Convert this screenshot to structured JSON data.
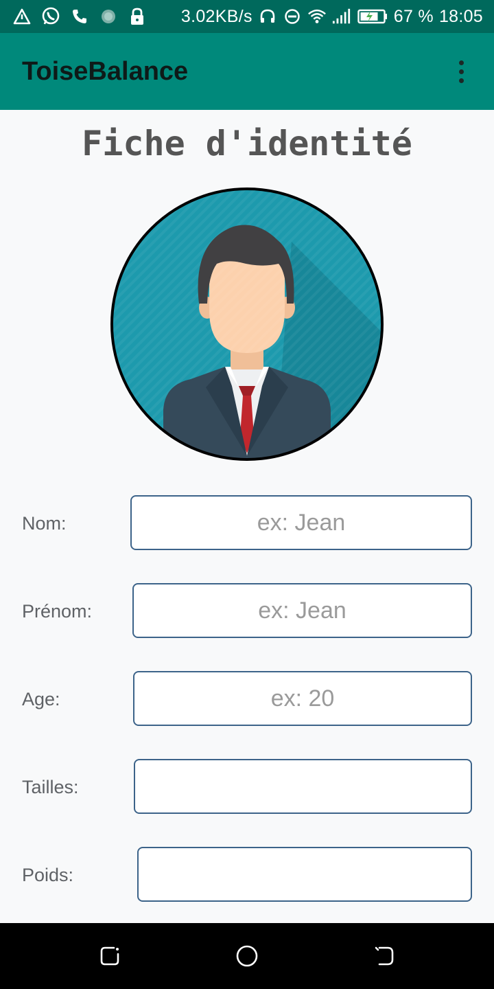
{
  "status_bar": {
    "network_speed": "3.02KB/s",
    "battery_percent": "67 %",
    "time": "18:05",
    "left_icons": [
      "warning-triangle-icon",
      "whatsapp-icon",
      "phone-icon",
      "sync-icon",
      "lock-icon"
    ],
    "right_icons": [
      "headphones-icon",
      "do-not-disturb-icon",
      "wifi-icon",
      "signal-icon",
      "battery-charging-icon"
    ]
  },
  "app_bar": {
    "title": "ToiseBalance",
    "menu_icon": "overflow-menu-icon"
  },
  "page": {
    "title": "Fiche d'identité",
    "avatar_icon": "businessman-avatar-icon"
  },
  "form": {
    "fields": [
      {
        "label": "Nom:",
        "placeholder": "ex: Jean",
        "value": ""
      },
      {
        "label": "Prénom:",
        "placeholder": "ex: Jean",
        "value": ""
      },
      {
        "label": "Age:",
        "placeholder": "ex: 20",
        "value": ""
      },
      {
        "label": "Tailles:",
        "placeholder": "",
        "value": ""
      },
      {
        "label": "Poids:",
        "placeholder": "",
        "value": ""
      }
    ]
  },
  "nav_bar": {
    "buttons": [
      "recent-apps-icon",
      "home-icon",
      "back-icon"
    ]
  },
  "colors": {
    "status_bar": "#00695c",
    "app_bar": "#00897b",
    "input_border": "#3c6389",
    "avatar_bg": "#1d9aad",
    "suit": "#354a5a",
    "tie": "#c1272d"
  }
}
